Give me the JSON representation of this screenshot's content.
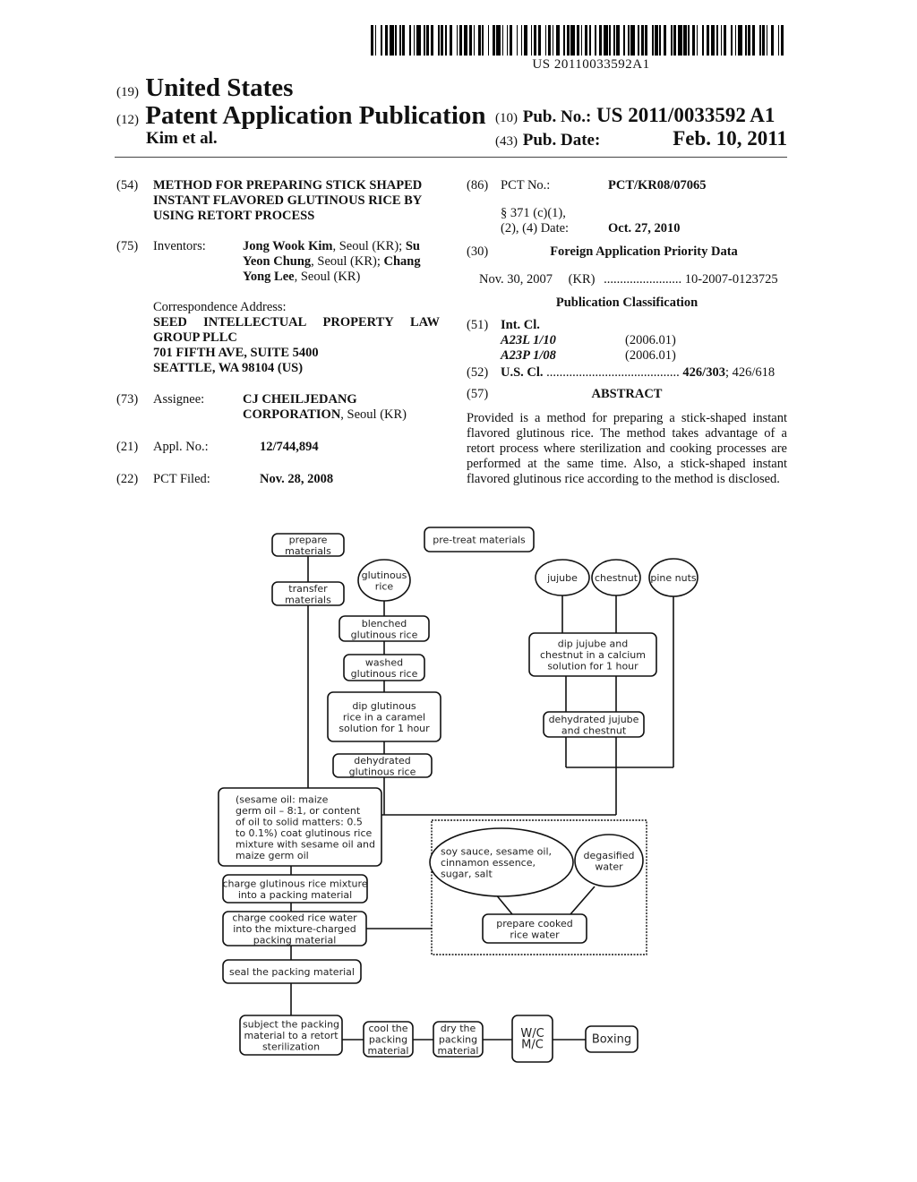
{
  "header": {
    "barcode_number": "US 20110033592A1",
    "code_19": "(19)",
    "country": "United States",
    "code_12": "(12)",
    "doc_type": "Patent Application Publication",
    "authors": "Kim et al.",
    "code_10": "(10)",
    "pub_no_label": "Pub. No.:",
    "pub_no_value": "US 2011/0033592 A1",
    "code_43": "(43)",
    "pub_date_label": "Pub. Date:",
    "pub_date_value": "Feb. 10, 2011"
  },
  "left_column": {
    "title": {
      "code": "(54)",
      "lines": [
        "METHOD FOR PREPARING STICK SHAPED",
        "INSTANT FLAVORED GLUTINOUS RICE BY",
        "USING RETORT PROCESS"
      ]
    },
    "inventors": {
      "code": "(75)",
      "label": "Inventors:",
      "line1_bold": "Jong Wook Kim",
      "line1_rest": ", Seoul (KR); ",
      "line1_bold2": "Su",
      "line2_bold": "Yeon Chung",
      "line2_rest": ", Seoul (KR); ",
      "line2_bold2": "Chang",
      "line3_bold": "Yong Lee",
      "line3_rest": ", Seoul (KR)"
    },
    "correspondence": {
      "label": "Correspondence Address:",
      "line1_words": [
        "SEED",
        "INTELLECTUAL",
        "PROPERTY",
        "LAW"
      ],
      "line2": "GROUP PLLC",
      "line3": "701 FIFTH AVE, SUITE 5400",
      "line4": "SEATTLE, WA 98104 (US)"
    },
    "assignee": {
      "code": "(73)",
      "label": "Assignee:",
      "line1": "CJ CHEILJEDANG",
      "line2_bold": "CORPORATION",
      "line2_rest": ", Seoul (KR)"
    },
    "appl_no": {
      "code": "(21)",
      "label": "Appl. No.:",
      "value": "12/744,894"
    },
    "pct_filed": {
      "code": "(22)",
      "label": "PCT Filed:",
      "value": "Nov. 28, 2008"
    }
  },
  "right_column": {
    "pct_no": {
      "code": "(86)",
      "label": "PCT No.:",
      "value": "PCT/KR08/07065"
    },
    "section_371": {
      "line1": "§ 371 (c)(1),",
      "line2": "(2), (4) Date:",
      "value": "Oct. 27, 2010"
    },
    "foreign_priority": {
      "code": "(30)",
      "heading": "Foreign Application Priority Data",
      "date": "Nov. 30, 2007",
      "country": "(KR)",
      "dots": "........................",
      "number": "10-2007-0123725"
    },
    "pub_class_heading": "Publication Classification",
    "int_cl": {
      "code": "(51)",
      "label": "Int. Cl.",
      "entries": [
        {
          "class": "A23L 1/10",
          "version": "(2006.01)"
        },
        {
          "class": "A23P 1/08",
          "version": "(2006.01)"
        }
      ]
    },
    "us_cl": {
      "code": "(52)",
      "label": "U.S. Cl.",
      "dots": ".........................................",
      "primary": "426/303",
      "secondary": "; 426/618"
    },
    "abstract": {
      "code": "(57)",
      "heading": "ABSTRACT",
      "text": "Provided is a method for preparing a stick-shaped instant flavored glutinous rice. The method takes advantage of a retort process where sterilization and cooking processes are performed at the same time. Also, a stick-shaped instant flavored glutinous rice according to the method is disclosed."
    }
  },
  "diagram": {
    "prepare_materials": [
      "prepare",
      "materials"
    ],
    "pretreat_materials": [
      "pre-treat materials"
    ],
    "transfer_materials": [
      "transfer",
      "materials"
    ],
    "glutinous_rice": [
      "glutinous",
      "rice"
    ],
    "blanched_rice": [
      "blenched",
      "glutinous rice"
    ],
    "washed_rice": [
      "washed",
      "glutinous rice"
    ],
    "dip_caramel": [
      "dip glutinous",
      "rice in a caramel",
      "solution for 1 hour"
    ],
    "dehydrated_rice": [
      "dehydrated",
      "glutinous rice"
    ],
    "jujube": [
      "jujube"
    ],
    "chestnut": [
      "chestnut"
    ],
    "pine_nuts": [
      "pine nuts"
    ],
    "dip_calcium": [
      "dip jujube and",
      "chestnut in a calcium",
      "solution for 1 hour"
    ],
    "dehydrated_jujube": [
      "dehydrated jujube",
      "and chestnut"
    ],
    "coat_oil": [
      "(sesame oil: maize",
      "germ oil – 8:1, or content",
      "of oil to solid matters: 0.5",
      "to 0.1%) coat glutinous rice",
      "mixture with sesame oil and",
      "maize germ oil"
    ],
    "seasonings": [
      "soy sauce, sesame oil,",
      "cinnamon essence,",
      "sugar, salt"
    ],
    "degasified_water": [
      "degasified",
      "water"
    ],
    "prepare_rice_water": [
      "prepare cooked",
      "rice water"
    ],
    "charge_mixture": [
      "charge glutinous rice mixture",
      "into a packing material"
    ],
    "charge_water": [
      "charge cooked rice water",
      "into the mixture-charged",
      "packing material"
    ],
    "seal": [
      "seal the packing material"
    ],
    "retort": [
      "subject the packing",
      "material to a retort",
      "sterilization"
    ],
    "cool": [
      "cool the",
      "packing",
      "material"
    ],
    "dry": [
      "dry the",
      "packing",
      "material"
    ],
    "wc_mc": [
      "W/C",
      "M/C"
    ],
    "boxing": [
      "Boxing"
    ]
  }
}
